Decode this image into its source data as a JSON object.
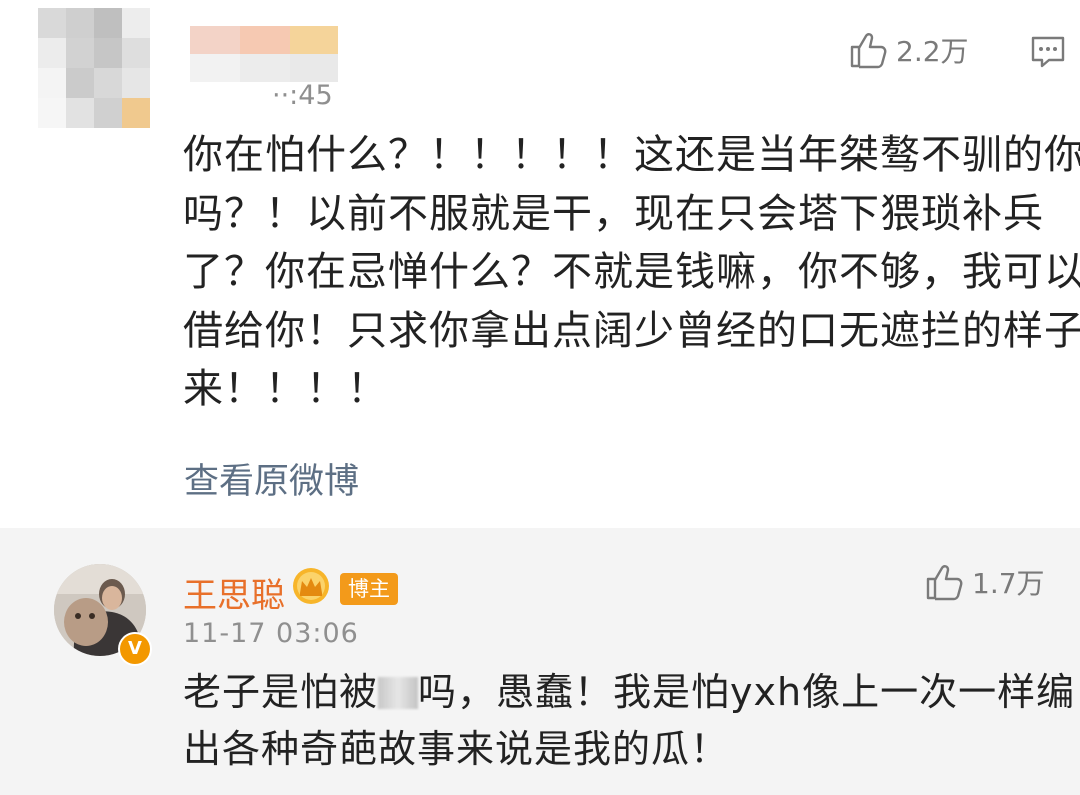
{
  "comment1": {
    "time": "··:45",
    "likes": "2.2万",
    "lines": [
      "你在怕什么？！！！！！这还是当年桀骜不驯的你",
      "吗？！以前不服就是干，现在只会塔下猥琐补兵",
      "了？你在忌惮什么？不就是钱嘛，你不够，我可以",
      "借给你！只求你拿出点阔少曾经的口无遮拦的样子",
      "来！！！！"
    ],
    "view_original": "查看原微博"
  },
  "reply": {
    "name": "王思聪",
    "host_tag": "博主",
    "time": "11-17 03:06",
    "likes": "1.7万",
    "line1_before": "老子是怕被",
    "line1_after": "吗，愚蠢！我是怕yxh像上一次一样编",
    "line2": "出各种奇葩故事来说是我的瓜！"
  },
  "colors": {
    "name_accent": "#e8702a",
    "host_tag_bg": "#f39a1a",
    "link": "#5d6f84",
    "reply_bg": "#f4f4f4"
  },
  "icons": [
    "thumbs-up-icon",
    "comment-icon",
    "crown-icon",
    "verified-v-icon"
  ]
}
